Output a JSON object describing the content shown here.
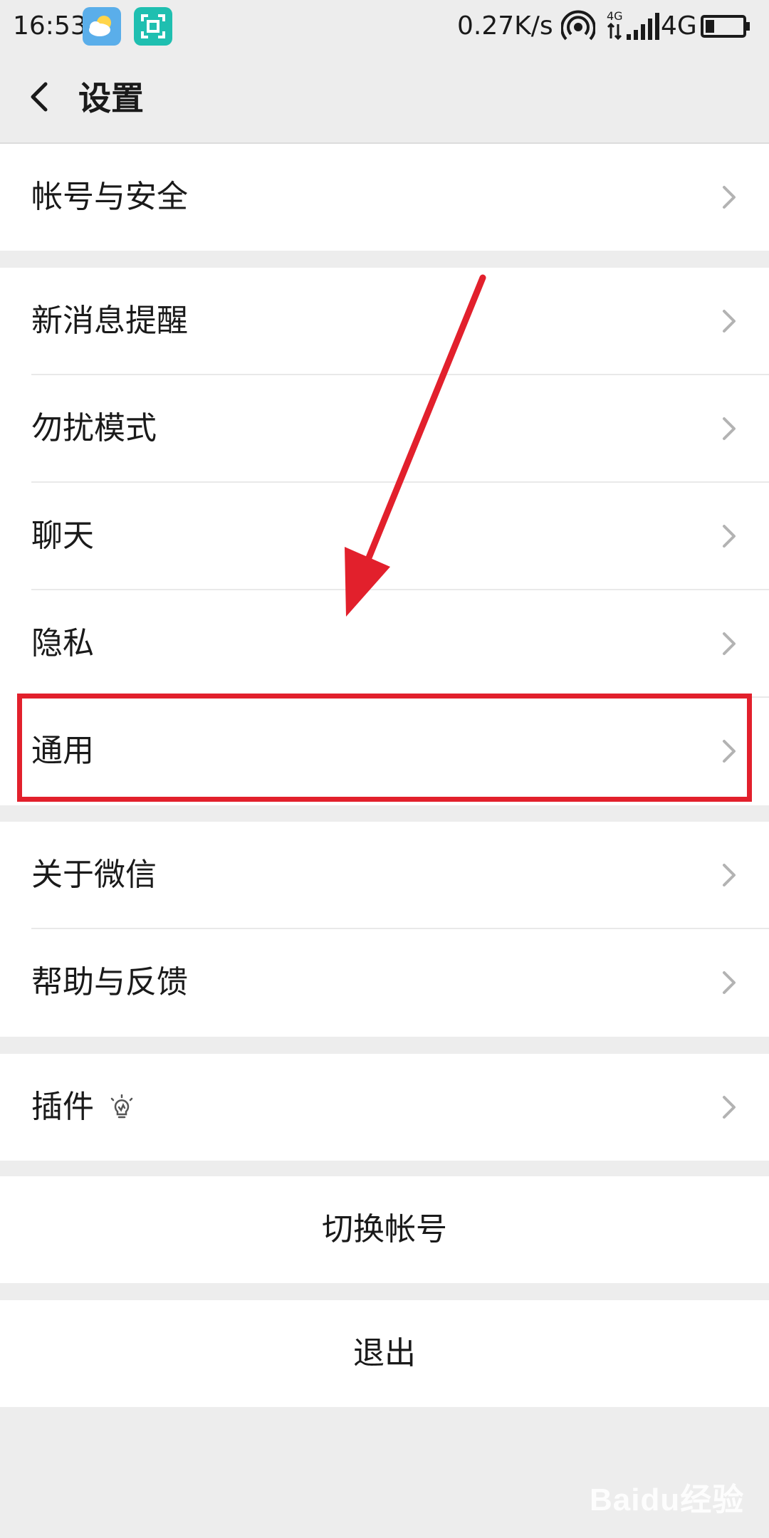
{
  "status_bar": {
    "time": "16:53",
    "network_speed": "0.27K/s",
    "network_type": "4G",
    "icons": [
      "weather-icon",
      "scan-icon",
      "hotspot-icon",
      "signal-icon",
      "battery-icon"
    ]
  },
  "header": {
    "title": "设置",
    "back_icon": "chevron-left-icon"
  },
  "groups": [
    {
      "items": [
        {
          "label": "帐号与安全"
        }
      ]
    },
    {
      "items": [
        {
          "label": "新消息提醒"
        },
        {
          "label": "勿扰模式"
        },
        {
          "label": "聊天"
        },
        {
          "label": "隐私"
        },
        {
          "label": "通用"
        }
      ]
    },
    {
      "items": [
        {
          "label": "关于微信"
        },
        {
          "label": "帮助与反馈"
        }
      ]
    },
    {
      "items": [
        {
          "label": "插件"
        }
      ]
    }
  ],
  "actions": {
    "switch_account": "切换帐号",
    "logout": "退出"
  },
  "annotation": {
    "highlight_color": "#e2202c",
    "highlighted_item": "通用"
  },
  "watermark": "Baidu经验"
}
